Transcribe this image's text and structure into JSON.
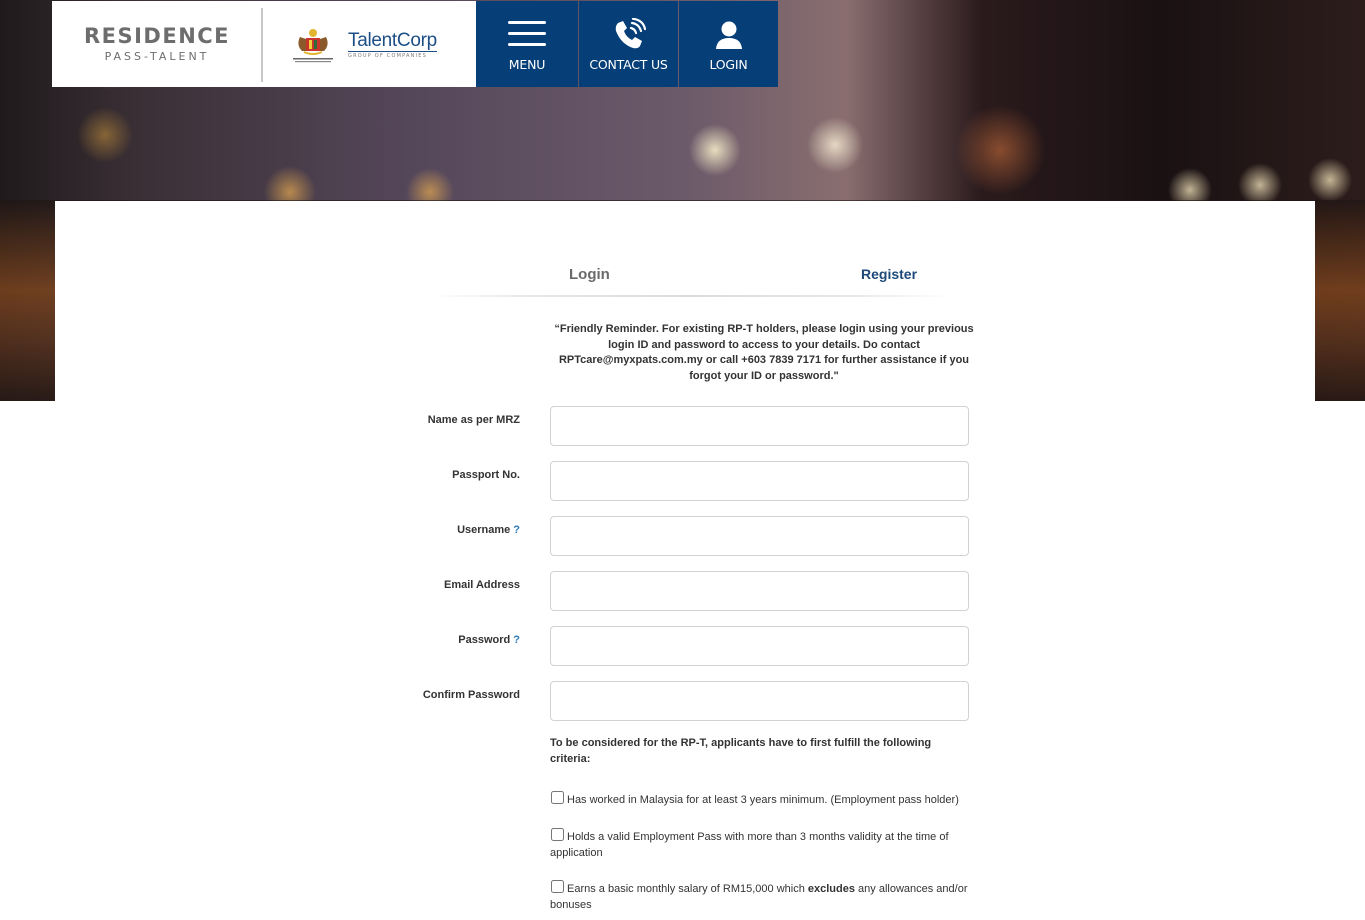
{
  "header": {
    "brand_title": "RESIDENCE",
    "brand_subtitle": "PASS-TALENT",
    "ministry_logo_label": "MINISTRY OF HUMAN RESOURCES",
    "partner_name": "TalentCorp",
    "partner_tagline": "GROUP OF COMPANIES",
    "nav": [
      {
        "label": "MENU",
        "icon": "hamburger-menu-icon"
      },
      {
        "label": "CONTACT US",
        "icon": "phone-icon"
      },
      {
        "label": "LOGIN",
        "icon": "user-icon"
      }
    ],
    "nav_color": "#063f78"
  },
  "tabs": [
    {
      "label": "Login",
      "active": false
    },
    {
      "label": "Register",
      "active": true
    }
  ],
  "reminder": "“Friendly Reminder. For existing RP-T holders, please login using your previous login ID and password to access to your details. Do contact RPTcare@myxpats.com.my or call +603 7839 7171 for further assistance if you forgot your ID or password.\"",
  "form": {
    "fields": [
      {
        "label": "Name as per MRZ",
        "help": "",
        "value": "",
        "placeholder": ""
      },
      {
        "label": "Passport No.",
        "help": "",
        "value": "",
        "placeholder": ""
      },
      {
        "label": "Username",
        "help": "?",
        "value": "",
        "placeholder": ""
      },
      {
        "label": "Email Address",
        "help": "",
        "value": "",
        "placeholder": ""
      },
      {
        "label": "Password",
        "help": "?",
        "value": "",
        "placeholder": ""
      },
      {
        "label": "Confirm Password",
        "help": "",
        "value": "",
        "placeholder": ""
      }
    ],
    "criteria_intro": "To be considered for the RP-T, applicants have to first fulfill the following criteria:",
    "criteria": [
      {
        "text": "Has worked in Malaysia for at least 3 years minimum. (Employment pass holder)",
        "checked": false
      },
      {
        "text": "Holds a valid Employment Pass with more than 3 months validity at the time of application",
        "checked": false
      },
      {
        "text_before": "Earns a basic monthly salary of RM15,000 which ",
        "text_bold": "excludes",
        "text_after": " any allowances and/or bonuses",
        "checked": false
      }
    ]
  }
}
